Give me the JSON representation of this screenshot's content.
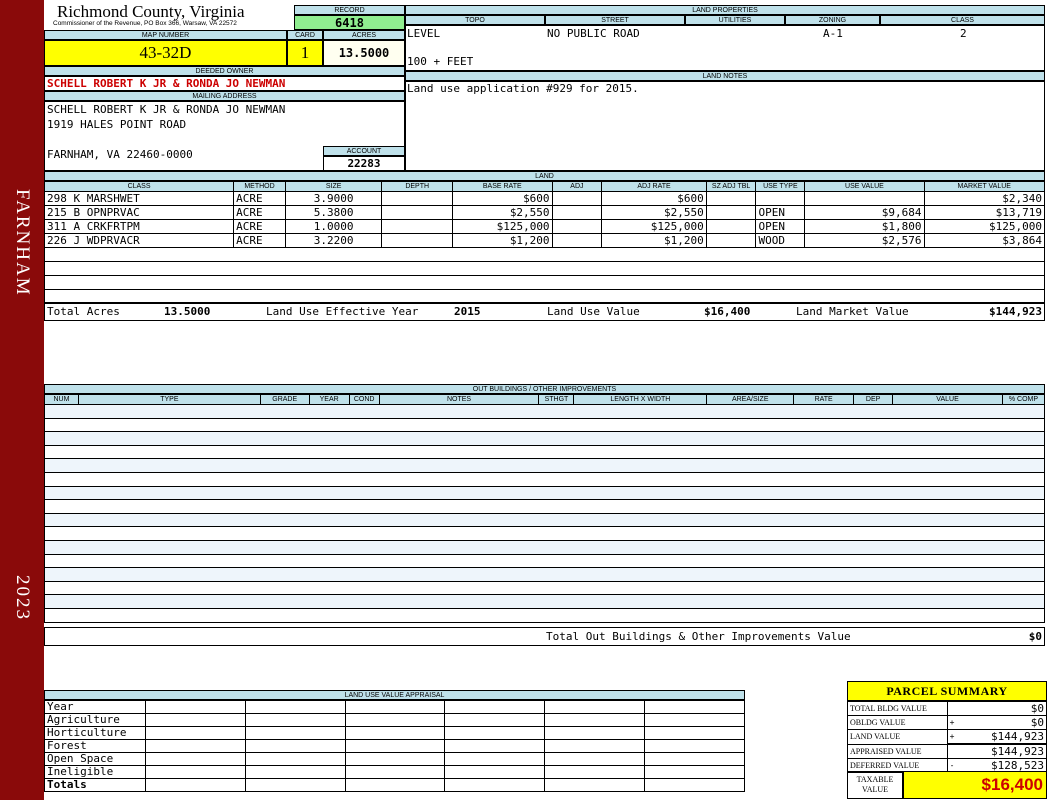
{
  "sidebar": {
    "district": "FARNHAM",
    "year": "2023"
  },
  "header": {
    "county": "Richmond County, Virginia",
    "subline": "Commissioner of the Revenue, PO Box 366, Warsaw, VA 22572"
  },
  "record": {
    "label": "RECORD",
    "value": "6418"
  },
  "map_number": {
    "label": "MAP NUMBER",
    "value": "43-32D"
  },
  "card": {
    "label": "CARD",
    "value": "1"
  },
  "acres": {
    "label": "ACRES",
    "value": "13.5000"
  },
  "deeded_owner": {
    "label": "DEEDED OWNER",
    "value": "SCHELL ROBERT K JR & RONDA JO NEWMAN"
  },
  "mailing": {
    "label": "MAILING ADDRESS",
    "line1": "SCHELL ROBERT K JR & RONDA JO NEWMAN",
    "line2": "1919 HALES POINT ROAD",
    "line3": "FARNHAM, VA 22460-0000"
  },
  "account": {
    "label": "ACCOUNT",
    "value": "22283"
  },
  "land_properties": {
    "label": "LAND PROPERTIES",
    "headers": [
      "TOPO",
      "STREET",
      "UTILITIES",
      "ZONING",
      "CLASS"
    ],
    "topo": "LEVEL",
    "street": "NO PUBLIC ROAD",
    "utilities": "",
    "zoning": "A-1",
    "class": "2",
    "frontage": "100 + FEET"
  },
  "land_notes": {
    "label": "LAND NOTES",
    "text": "Land use application #929 for 2015."
  },
  "land": {
    "label": "LAND",
    "headers": [
      "CLASS",
      "METHOD",
      "SIZE",
      "DEPTH",
      "BASE RATE",
      "ADJ",
      "ADJ RATE",
      "SZ ADJ TBL",
      "USE TYPE",
      "USE VALUE",
      "MARKET VALUE"
    ],
    "rows": [
      {
        "class": "298 K MARSHWET",
        "method": "ACRE",
        "size": "3.9000",
        "depth": "",
        "base_rate": "$600",
        "adj": "",
        "adj_rate": "$600",
        "sz_adj": "",
        "use_type": "",
        "use_value": "",
        "market_value": "$2,340"
      },
      {
        "class": "215 B OPNPRVAC",
        "method": "ACRE",
        "size": "5.3800",
        "depth": "",
        "base_rate": "$2,550",
        "adj": "",
        "adj_rate": "$2,550",
        "sz_adj": "",
        "use_type": "OPEN",
        "use_value": "$9,684",
        "market_value": "$13,719"
      },
      {
        "class": "311 A CRKFRTPM",
        "method": "ACRE",
        "size": "1.0000",
        "depth": "",
        "base_rate": "$125,000",
        "adj": "",
        "adj_rate": "$125,000",
        "sz_adj": "",
        "use_type": "OPEN",
        "use_value": "$1,800",
        "market_value": "$125,000"
      },
      {
        "class": "226 J WDPRVACR",
        "method": "ACRE",
        "size": "3.2200",
        "depth": "",
        "base_rate": "$1,200",
        "adj": "",
        "adj_rate": "$1,200",
        "sz_adj": "",
        "use_type": "WOOD",
        "use_value": "$2,576",
        "market_value": "$3,864"
      }
    ],
    "totals": {
      "total_acres_label": "Total Acres",
      "total_acres": "13.5000",
      "effective_year_label": "Land Use Effective Year",
      "effective_year": "2015",
      "use_value_label": "Land Use Value",
      "use_value": "$16,400",
      "market_value_label": "Land Market Value",
      "market_value": "$144,923"
    }
  },
  "outbuildings": {
    "label": "OUT BUILDINGS / OTHER IMPROVEMENTS",
    "headers": [
      "NUM",
      "TYPE",
      "GRADE",
      "YEAR",
      "COND",
      "NOTES",
      "STHGT",
      "LENGTH X WIDTH",
      "AREA/SIZE",
      "RATE",
      "DEP",
      "VALUE",
      "% COMP"
    ],
    "total_label": "Total Out Buildings & Other Improvements Value",
    "total_value": "$0"
  },
  "land_use_appraisal": {
    "label": "LAND USE VALUE APPRAISAL",
    "rows": [
      "Year",
      "Agriculture",
      "Horticulture",
      "Forest",
      "Open Space",
      "Ineligible",
      "Totals"
    ]
  },
  "parcel_summary": {
    "title": "PARCEL SUMMARY",
    "rows": [
      {
        "label": "TOTAL BLDG VALUE",
        "sign": "",
        "value": "$0"
      },
      {
        "label": "OBLDG VALUE",
        "sign": "+",
        "value": "$0"
      },
      {
        "label": "LAND VALUE",
        "sign": "+",
        "value": "$144,923"
      },
      {
        "label": "APPRAISED VALUE",
        "sign": "",
        "value": "$144,923"
      },
      {
        "label": "DEFERRED VALUE",
        "sign": "-",
        "value": "$128,523"
      }
    ],
    "taxable_label_1": "TAXABLE",
    "taxable_label_2": "VALUE",
    "taxable_value": "$16,400"
  },
  "colors": {
    "sidebar": "#8a0a0a",
    "header_band": "#bfe1ea",
    "highlight_yellow": "#ffff00",
    "record_green": "#90ee90",
    "red_text": "#cc0000"
  }
}
